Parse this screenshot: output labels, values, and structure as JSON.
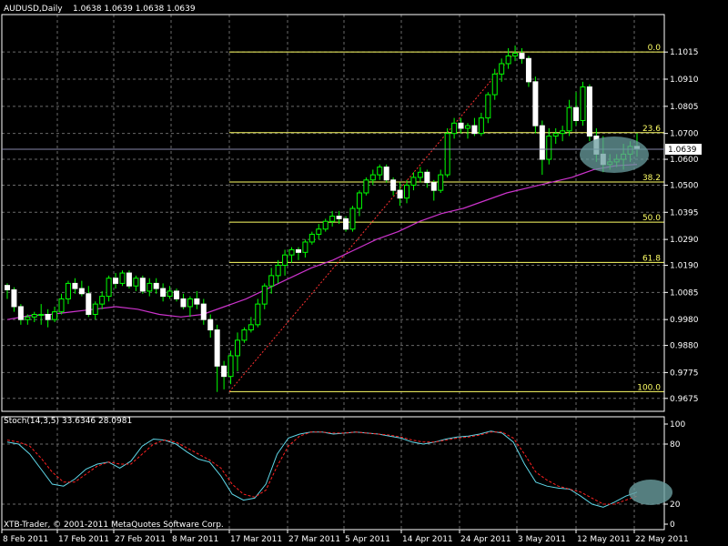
{
  "chart_data": [
    {
      "type": "candlestick",
      "title": "AUDUSD,Daily",
      "ohlc_readout": "1.0638 1.0639 1.0638 1.0639",
      "grid": true,
      "ylim": [
        0.9625,
        1.116
      ],
      "y_ticks": [
        "1.1015",
        "1.0910",
        "1.0805",
        "1.0700",
        "1.0600",
        "1.0500",
        "1.0395",
        "1.0290",
        "1.0190",
        "1.0085",
        "0.9980",
        "0.9880",
        "0.9775",
        "0.9675"
      ],
      "x_ticks": [
        "8 Feb 2011",
        "17 Feb 2011",
        "27 Feb 2011",
        "8 Mar 2011",
        "17 Mar 2011",
        "27 Mar 2011",
        "5 Apr 2011",
        "14 Apr 2011",
        "24 Apr 2011",
        "3 May 2011",
        "12 May 2011",
        "22 May 2011"
      ],
      "last_price": "1.0639",
      "fibonacci": [
        {
          "label": "0.0",
          "price": 1.1015
        },
        {
          "label": "23.6",
          "price": 1.0703
        },
        {
          "label": "38.2",
          "price": 1.0512
        },
        {
          "label": "50.0",
          "price": 1.0357
        },
        {
          "label": "61.8",
          "price": 1.0201
        },
        {
          "label": "100.0",
          "price": 0.9701
        }
      ],
      "candles": [
        [
          1.0112,
          1.012,
          1.006,
          1.0095
        ],
        [
          1.0095,
          1.0105,
          1.001,
          1.003
        ],
        [
          1.003,
          1.004,
          0.996,
          0.998
        ],
        [
          0.998,
          1.0,
          0.996,
          0.999
        ],
        [
          0.999,
          1.001,
          0.997,
          1.0
        ],
        [
          1.0,
          1.004,
          0.996,
          1.0
        ],
        [
          1.0,
          1.002,
          0.995,
          0.998
        ],
        [
          0.998,
          1.003,
          0.997,
          1.001
        ],
        [
          1.001,
          1.008,
          1.0,
          1.006
        ],
        [
          1.006,
          1.013,
          1.004,
          1.012
        ],
        [
          1.012,
          1.014,
          1.008,
          1.01
        ],
        [
          1.01,
          1.013,
          1.007,
          1.008
        ],
        [
          1.008,
          1.011,
          0.999,
          1.0
        ],
        [
          1.0,
          1.005,
          0.998,
          1.004
        ],
        [
          1.004,
          1.009,
          1.002,
          1.007
        ],
        [
          1.007,
          1.015,
          1.005,
          1.014
        ],
        [
          1.014,
          1.016,
          1.01,
          1.012
        ],
        [
          1.012,
          1.017,
          1.011,
          1.016
        ],
        [
          1.016,
          1.017,
          1.01,
          1.011
        ],
        [
          1.011,
          1.015,
          1.009,
          1.014
        ],
        [
          1.014,
          1.015,
          1.008,
          1.009
        ],
        [
          1.009,
          1.014,
          1.007,
          1.012
        ],
        [
          1.012,
          1.014,
          1.008,
          1.01
        ],
        [
          1.01,
          1.012,
          1.005,
          1.007
        ],
        [
          1.007,
          1.011,
          1.006,
          1.009
        ],
        [
          1.009,
          1.01,
          1.005,
          1.006
        ],
        [
          1.006,
          1.008,
          1.002,
          1.003
        ],
        [
          1.003,
          1.007,
          0.999,
          1.006
        ],
        [
          1.006,
          1.009,
          1.002,
          1.004
        ],
        [
          1.004,
          1.006,
          0.996,
          0.998
        ],
        [
          0.998,
          1.0,
          0.991,
          0.994
        ],
        [
          0.994,
          0.996,
          0.97,
          0.98
        ],
        [
          0.98,
          0.982,
          0.971,
          0.976
        ],
        [
          0.976,
          0.986,
          0.973,
          0.984
        ],
        [
          0.984,
          0.993,
          0.978,
          0.99
        ],
        [
          0.99,
          0.995,
          0.989,
          0.994
        ],
        [
          0.994,
          0.999,
          0.993,
          0.996
        ],
        [
          0.996,
          1.006,
          0.995,
          1.004
        ],
        [
          1.004,
          1.012,
          1.002,
          1.011
        ],
        [
          1.011,
          1.018,
          1.008,
          1.015
        ],
        [
          1.015,
          1.021,
          1.012,
          1.019
        ],
        [
          1.019,
          1.025,
          1.015,
          1.023
        ],
        [
          1.023,
          1.026,
          1.02,
          1.025
        ],
        [
          1.025,
          1.026,
          1.021,
          1.024
        ],
        [
          1.024,
          1.029,
          1.022,
          1.028
        ],
        [
          1.028,
          1.032,
          1.027,
          1.031
        ],
        [
          1.031,
          1.035,
          1.029,
          1.033
        ],
        [
          1.033,
          1.037,
          1.032,
          1.036
        ],
        [
          1.036,
          1.04,
          1.034,
          1.038
        ],
        [
          1.038,
          1.04,
          1.035,
          1.037
        ],
        [
          1.037,
          1.038,
          1.032,
          1.033
        ],
        [
          1.033,
          1.042,
          1.032,
          1.041
        ],
        [
          1.041,
          1.048,
          1.038,
          1.047
        ],
        [
          1.047,
          1.053,
          1.046,
          1.052
        ],
        [
          1.052,
          1.056,
          1.05,
          1.054
        ],
        [
          1.054,
          1.058,
          1.052,
          1.057
        ],
        [
          1.057,
          1.058,
          1.051,
          1.052
        ],
        [
          1.052,
          1.053,
          1.046,
          1.048
        ],
        [
          1.048,
          1.051,
          1.042,
          1.045
        ],
        [
          1.045,
          1.052,
          1.043,
          1.05
        ],
        [
          1.05,
          1.055,
          1.048,
          1.053
        ],
        [
          1.053,
          1.057,
          1.051,
          1.055
        ],
        [
          1.055,
          1.056,
          1.049,
          1.051
        ],
        [
          1.051,
          1.052,
          1.044,
          1.048
        ],
        [
          1.048,
          1.056,
          1.047,
          1.054
        ],
        [
          1.054,
          1.072,
          1.053,
          1.07
        ],
        [
          1.07,
          1.076,
          1.068,
          1.074
        ],
        [
          1.074,
          1.076,
          1.07,
          1.072
        ],
        [
          1.072,
          1.074,
          1.068,
          1.073
        ],
        [
          1.073,
          1.076,
          1.069,
          1.07
        ],
        [
          1.07,
          1.078,
          1.069,
          1.076
        ],
        [
          1.076,
          1.086,
          1.074,
          1.085
        ],
        [
          1.085,
          1.095,
          1.083,
          1.093
        ],
        [
          1.093,
          1.099,
          1.09,
          1.097
        ],
        [
          1.097,
          1.103,
          1.095,
          1.1
        ],
        [
          1.1,
          1.104,
          1.098,
          1.101
        ],
        [
          1.101,
          1.103,
          1.097,
          1.099
        ],
        [
          1.099,
          1.1,
          1.088,
          1.09
        ],
        [
          1.09,
          1.092,
          1.07,
          1.073
        ],
        [
          1.073,
          1.075,
          1.054,
          1.06
        ],
        [
          1.06,
          1.072,
          1.058,
          1.069
        ],
        [
          1.069,
          1.072,
          1.066,
          1.07
        ],
        [
          1.07,
          1.073,
          1.067,
          1.071
        ],
        [
          1.071,
          1.083,
          1.069,
          1.08
        ],
        [
          1.08,
          1.086,
          1.073,
          1.075
        ],
        [
          1.075,
          1.09,
          1.073,
          1.088
        ],
        [
          1.088,
          1.089,
          1.067,
          1.069
        ],
        [
          1.069,
          1.072,
          1.059,
          1.062
        ],
        [
          1.062,
          1.069,
          1.055,
          1.058
        ],
        [
          1.058,
          1.062,
          1.056,
          1.059
        ],
        [
          1.059,
          1.062,
          1.057,
          1.06
        ],
        [
          1.06,
          1.066,
          1.056,
          1.062
        ],
        [
          1.062,
          1.067,
          1.059,
          1.065
        ],
        [
          1.065,
          1.07,
          1.061,
          1.0639
        ]
      ],
      "ma_points": [
        [
          0.998,
          0.9995,
          1.0,
          1.001,
          1.002,
          1.003,
          1.002,
          1.0,
          0.999,
          1.0,
          1.003,
          1.006,
          1.01,
          1.014,
          1.018,
          1.021,
          1.025,
          1.029,
          1.032,
          1.036,
          1.039,
          1.041,
          1.044,
          1.047,
          1.049,
          1.051,
          1.053,
          1.056,
          1.0575,
          1.058
        ]
      ],
      "stochastic": {
        "label": "Stoch(14,3,5) 33.6346 28.0981",
        "ylim": [
          0,
          100
        ],
        "levels": [
          "100",
          "80",
          "20",
          "0"
        ],
        "main": [
          82,
          80,
          70,
          55,
          40,
          38,
          45,
          55,
          60,
          62,
          56,
          63,
          78,
          85,
          84,
          80,
          72,
          65,
          62,
          48,
          30,
          24,
          26,
          40,
          70,
          86,
          90,
          92,
          92,
          90,
          91,
          92,
          91,
          90,
          88,
          86,
          82,
          80,
          82,
          85,
          87,
          88,
          90,
          93,
          91,
          82,
          60,
          42,
          38,
          36,
          35,
          28,
          20,
          17,
          22,
          28,
          32
        ],
        "signal": [
          84,
          82,
          78,
          66,
          52,
          42,
          42,
          50,
          58,
          62,
          60,
          60,
          70,
          80,
          84,
          82,
          76,
          70,
          64,
          56,
          40,
          30,
          27,
          34,
          58,
          78,
          88,
          92,
          92,
          91,
          91,
          92,
          91,
          90,
          89,
          87,
          84,
          82,
          82,
          84,
          86,
          87,
          89,
          92,
          92,
          86,
          70,
          52,
          44,
          38,
          35,
          32,
          26,
          20,
          20,
          24,
          28
        ]
      },
      "footer": "XTB-Trader, © 2001-2011 MetaQuotes Software Corp."
    }
  ]
}
